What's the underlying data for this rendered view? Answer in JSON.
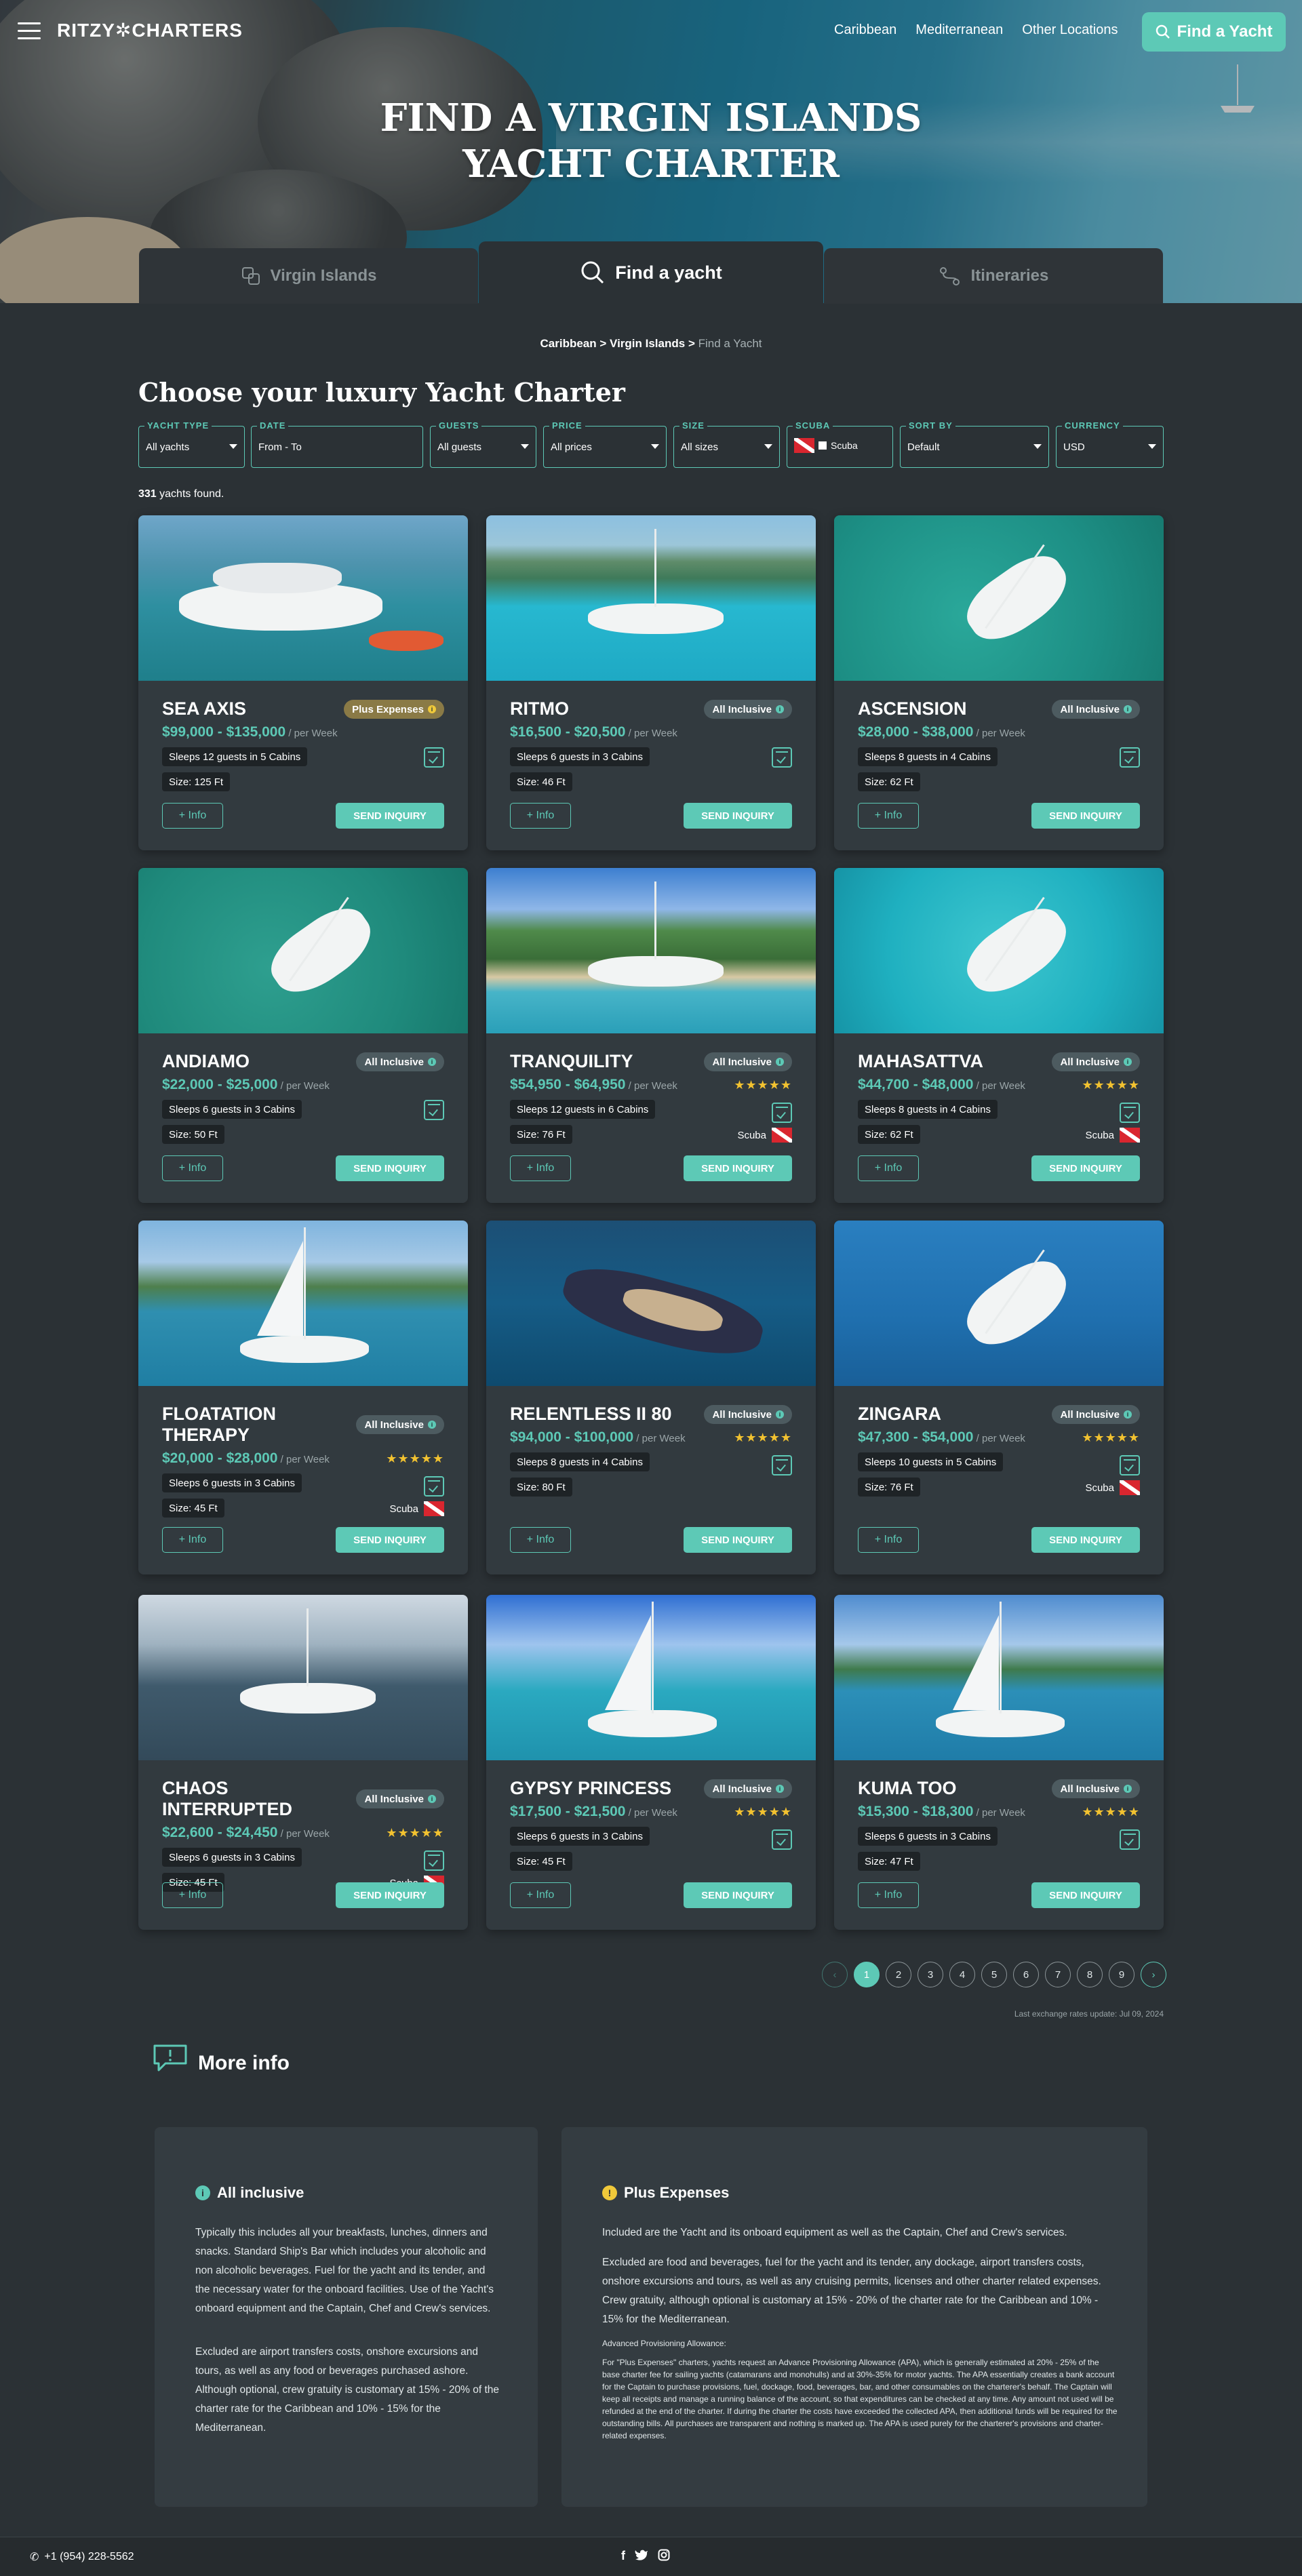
{
  "nav": {
    "logo": "RITZY✲CHARTERS",
    "links": [
      "Caribbean",
      "Mediterranean",
      "Other Locations"
    ],
    "cta": "Find a Yacht"
  },
  "hero": {
    "title": "FIND A VIRGIN ISLANDS YACHT CHARTER"
  },
  "tabs": [
    "Virgin Islands",
    "Find a yacht",
    "Itineraries"
  ],
  "breadcrumb": {
    "a": "Caribbean",
    "b": "Virgin Islands",
    "current": "Find a Yacht",
    "sep": ">"
  },
  "heading": "Choose your luxury Yacht Charter",
  "filters": [
    {
      "label": "YACHT TYPE",
      "value": "All yachts"
    },
    {
      "label": "DATE",
      "value": "From - To"
    },
    {
      "label": "GUESTS",
      "value": "All guests"
    },
    {
      "label": "PRICE",
      "value": "All prices"
    },
    {
      "label": "SIZE",
      "value": "All sizes"
    },
    {
      "label": "SCUBA",
      "value": "Scuba"
    },
    {
      "label": "SORT BY",
      "value": "Default"
    },
    {
      "label": "CURRENCY",
      "value": "USD"
    }
  ],
  "results": {
    "count": "331",
    "suffix": "yachts found."
  },
  "card_labels": {
    "per_week": "/ per Week",
    "info": "+ Info",
    "send": "SEND INQUIRY",
    "scuba": "Scuba"
  },
  "yachts": [
    {
      "name": "SEA AXIS",
      "badge": "Plus Expenses",
      "price": "$99,000 - $135,000",
      "guests": "Sleeps 12 guests in 5 Cabins",
      "size": "Size: 125 Ft",
      "stars": "",
      "scuba": false
    },
    {
      "name": "RITMO",
      "badge": "All Inclusive",
      "price": "$16,500 - $20,500",
      "guests": "Sleeps 6 guests in 3 Cabins",
      "size": "Size: 46 Ft",
      "stars": "",
      "scuba": false
    },
    {
      "name": "ASCENSION",
      "badge": "All Inclusive",
      "price": "$28,000 - $38,000",
      "guests": "Sleeps 8 guests in 4 Cabins",
      "size": "Size: 62 Ft",
      "stars": "",
      "scuba": false
    },
    {
      "name": "ANDIAMO",
      "badge": "All Inclusive",
      "price": "$22,000 - $25,000",
      "guests": "Sleeps 6 guests in 3 Cabins",
      "size": "Size: 50 Ft",
      "stars": "",
      "scuba": false
    },
    {
      "name": "TRANQUILITY",
      "badge": "All Inclusive",
      "price": "$54,950 - $64,950",
      "guests": "Sleeps 12 guests in 6 Cabins",
      "size": "Size: 76 Ft",
      "stars": "★★★★★",
      "scuba": true
    },
    {
      "name": "MAHASATTVA",
      "badge": "All Inclusive",
      "price": "$44,700 - $48,000",
      "guests": "Sleeps 8 guests in 4 Cabins",
      "size": "Size: 62 Ft",
      "stars": "★★★★★",
      "scuba": true
    },
    {
      "name": "FLOATATION THERAPY",
      "badge": "All Inclusive",
      "price": "$20,000 - $28,000",
      "guests": "Sleeps 6 guests in 3 Cabins",
      "size": "Size: 45 Ft",
      "stars": "★★★★★",
      "scuba": true
    },
    {
      "name": "RELENTLESS II 80",
      "badge": "All Inclusive",
      "price": "$94,000 - $100,000",
      "guests": "Sleeps 8 guests in 4 Cabins",
      "size": "Size: 80 Ft",
      "stars": "★★★★★",
      "scuba": false
    },
    {
      "name": "ZINGARA",
      "badge": "All Inclusive",
      "price": "$47,300 - $54,000",
      "guests": "Sleeps 10 guests in 5 Cabins",
      "size": "Size: 76 Ft",
      "stars": "★★★★★",
      "scuba": true
    },
    {
      "name": "CHAOS INTERRUPTED",
      "badge": "All Inclusive",
      "price": "$22,600 - $24,450",
      "guests": "Sleeps 6 guests in 3 Cabins",
      "size": "Size: 45 Ft",
      "stars": "★★★★★",
      "scuba": true
    },
    {
      "name": "GYPSY PRINCESS",
      "badge": "All Inclusive",
      "price": "$17,500 - $21,500",
      "guests": "Sleeps 6 guests in 3 Cabins",
      "size": "Size: 45 Ft",
      "stars": "★★★★★",
      "scuba": false
    },
    {
      "name": "KUMA TOO",
      "badge": "All Inclusive",
      "price": "$15,300 - $18,300",
      "guests": "Sleeps 6 guests in 3 Cabins",
      "size": "Size: 47 Ft",
      "stars": "★★★★★",
      "scuba": false
    }
  ],
  "pagination": {
    "prev": "‹",
    "next": "›",
    "pages": [
      "1",
      "2",
      "3",
      "4",
      "5",
      "6",
      "7",
      "8",
      "9"
    ],
    "current": "1"
  },
  "rates_note": "Last exchange rates update: Jul 09, 2024",
  "more_info": {
    "title": "More info",
    "all_inclusive": {
      "title": "All inclusive",
      "p1": "Typically this includes all your breakfasts, lunches, dinners and snacks. Standard Ship's Bar which includes your alcoholic and non alcoholic beverages. Fuel for the yacht and its tender, and the necessary water for the onboard facilities. Use of the Yacht's onboard equipment and the Captain, Chef and Crew's services.",
      "p2": "Excluded are airport transfers costs, onshore excursions and tours, as well as any food or beverages purchased ashore. Although optional, crew gratuity is customary at 15% - 20% of the charter rate for the Caribbean and 10% - 15% for the Mediterranean."
    },
    "plus_expenses": {
      "title": "Plus Expenses",
      "p1": "Included are the Yacht and its onboard equipment as well as the Captain, Chef and Crew's services.",
      "p2": "Excluded are food and beverages, fuel for the yacht and its tender, any dockage, airport transfers costs, onshore excursions and tours, as well as any cruising permits, licenses and other charter related expenses. Crew gratuity, although optional is customary at 15% - 20% of the charter rate for the Caribbean and 10% - 15% for the Mediterranean.",
      "apa_title": "Advanced Provisioning Allowance:",
      "apa": "For \"Plus Expenses\" charters, yachts request an Advance Provisioning Allowance (APA), which is generally estimated at 20% - 25% of the base charter fee for sailing yachts (catamarans and monohulls) and at 30%-35% for motor yachts. The APA essentially creates a bank account for the Captain to purchase provisions, fuel, dockage, food, beverages, bar, and other consumables on the charterer's behalf. The Captain will keep all receipts and manage a running balance of the account, so that expenditures can be checked at any time. Any amount not used will be refunded at the end of the charter. If during the charter the costs have exceeded the collected APA, then additional funds will be required for the outstanding bills. All purchases are transparent and nothing is marked up. The APA is used purely for the charterer's provisions and charter-related expenses."
    }
  },
  "footer": {
    "phone": "+1 (954) 228-5562",
    "social": [
      "facebook-icon",
      "twitter-icon",
      "instagram-icon"
    ]
  },
  "colors": {
    "accent": "#5dc9b6",
    "bg": "#2b3135",
    "card": "#323a3f",
    "star": "#f2c230",
    "plus_expenses_badge": "#8a7a46"
  }
}
